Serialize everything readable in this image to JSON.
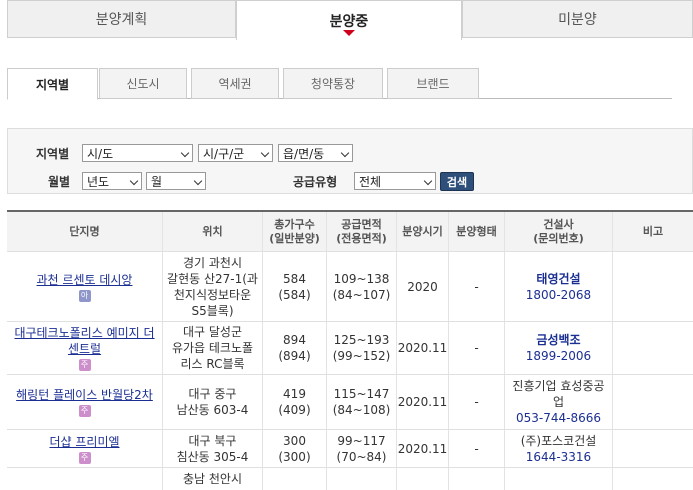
{
  "top_tabs": [
    {
      "label": "분양계획"
    },
    {
      "label": "분양중"
    },
    {
      "label": "미분양"
    }
  ],
  "sub_tabs": [
    {
      "label": "지역별"
    },
    {
      "label": "신도시"
    },
    {
      "label": "역세권"
    },
    {
      "label": "청약통장"
    },
    {
      "label": "브랜드"
    }
  ],
  "search": {
    "region_label": "지역별",
    "sido": "시/도",
    "sigungu": "시/구/군",
    "eupmyeondong": "읍/면/동",
    "month_label": "월별",
    "year": "년도",
    "month": "월",
    "supply_label": "공급유형",
    "supply_value": "전체",
    "search_button": "검색"
  },
  "table": {
    "headers": {
      "name": "단지명",
      "location": "위치",
      "households_1": "총가구수",
      "households_2": "(일반분양)",
      "area_1": "공급면적",
      "area_2": "(전용면적)",
      "period": "분양시기",
      "type": "분양형태",
      "builder_1": "건설사",
      "builder_2": "(문의번호)",
      "note": "비고"
    },
    "rows": [
      {
        "name": "과천 르센토 데시앙",
        "badge": "아",
        "location": [
          "경기 과천시",
          "갈현동 산27-1(과",
          "천지식정보타운",
          "S5블록)"
        ],
        "households": "584",
        "households_general": "(584)",
        "area": "109~138",
        "area_exclusive": "(84~107)",
        "period": "2020",
        "type": "-",
        "builder": "태영건설",
        "phone": "1800-2068"
      },
      {
        "name": "대구테크노폴리스 예미지 더센트럴",
        "badge": "주",
        "location": [
          "대구 달성군",
          "유가읍 테크노폴",
          "리스 RC블록"
        ],
        "households": "894",
        "households_general": "(894)",
        "area": "125~193",
        "area_exclusive": "(99~152)",
        "period": "2020.11",
        "type": "-",
        "builder": "금성백조",
        "phone": "1899-2006"
      },
      {
        "name": "해링턴 플레이스 반월당2차",
        "badge": "주",
        "location": [
          "대구 중구",
          "남산동 603-4"
        ],
        "households": "419",
        "households_general": "(409)",
        "area": "115~147",
        "area_exclusive": "(84~108)",
        "period": "2020.11",
        "type": "-",
        "builder": "진흥기업 효성중공업",
        "phone": "053-744-8666"
      },
      {
        "name": "더샵 프리미엘",
        "badge": "주",
        "location": [
          "대구 북구",
          "침산동 305-4"
        ],
        "households": "300",
        "households_general": "(300)",
        "area": "99~117",
        "area_exclusive": "(70~84)",
        "period": "2020.11",
        "type": "-",
        "builder": "(주)포스코건설",
        "phone": "1644-3316"
      },
      {
        "name": "",
        "badge": "",
        "location": [
          "충남 천안시"
        ],
        "households": "",
        "households_general": "",
        "area": "",
        "area_exclusive": "",
        "period": "",
        "type": "",
        "builder": "",
        "phone": ""
      }
    ]
  },
  "colors": {
    "link": "#1b2f93",
    "active_arrow": "#d0021b",
    "search_button": "#2d4f7a"
  }
}
